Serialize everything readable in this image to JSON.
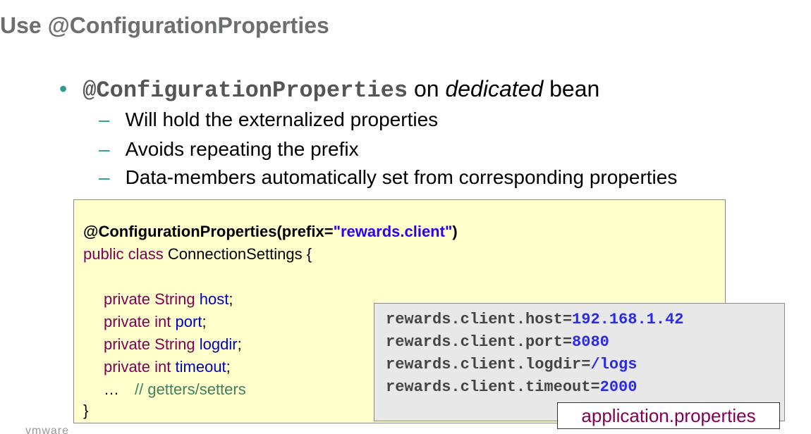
{
  "slide": {
    "title": "Use @ConfigurationProperties"
  },
  "bullets": {
    "main": {
      "bullet_glyph": "•",
      "code": "@ConfigurationProperties",
      "text_on": " on ",
      "text_dedicated": "dedicated",
      "text_bean": " bean"
    },
    "subs": [
      "Will hold the externalized properties",
      "Avoids repeating the prefix",
      "Data-members automatically set from corresponding properties"
    ],
    "dash_glyph": "–"
  },
  "code": {
    "annotation": "@ConfigurationProperties",
    "paren_open": "(prefix=",
    "prefix_string": "\"rewards.client\"",
    "paren_close": ")",
    "class_kw": "public class",
    "class_name": " ConnectionSettings {",
    "fields": [
      {
        "mods": "private String",
        "name": "host"
      },
      {
        "mods": "private int",
        "name": "port"
      },
      {
        "mods": "private String",
        "name": "logdir"
      },
      {
        "mods": "private int",
        "name": "timeout"
      }
    ],
    "ellipsis": "…",
    "comment": "// getters/setters",
    "closing_brace": "}"
  },
  "properties": {
    "lines": [
      {
        "key": "rewards.client.host=",
        "value": "192.168.1.42"
      },
      {
        "key": "rewards.client.port=",
        "value": "8080"
      },
      {
        "key": "rewards.client.logdir=",
        "value": "/logs"
      },
      {
        "key": "rewards.client.timeout=",
        "value": "2000"
      }
    ],
    "file_label": "application.properties"
  },
  "footer": {
    "logo": "vmware"
  },
  "colors": {
    "title_gray": "#6d6e71",
    "bullet_teal": "#2e9a8e",
    "code_bg": "#ffffcc",
    "keyword": "#7f0055",
    "field": "#0000c0",
    "string": "#2a00ff",
    "comment": "#3f7f5f",
    "props_bg": "#e8e8e8"
  }
}
